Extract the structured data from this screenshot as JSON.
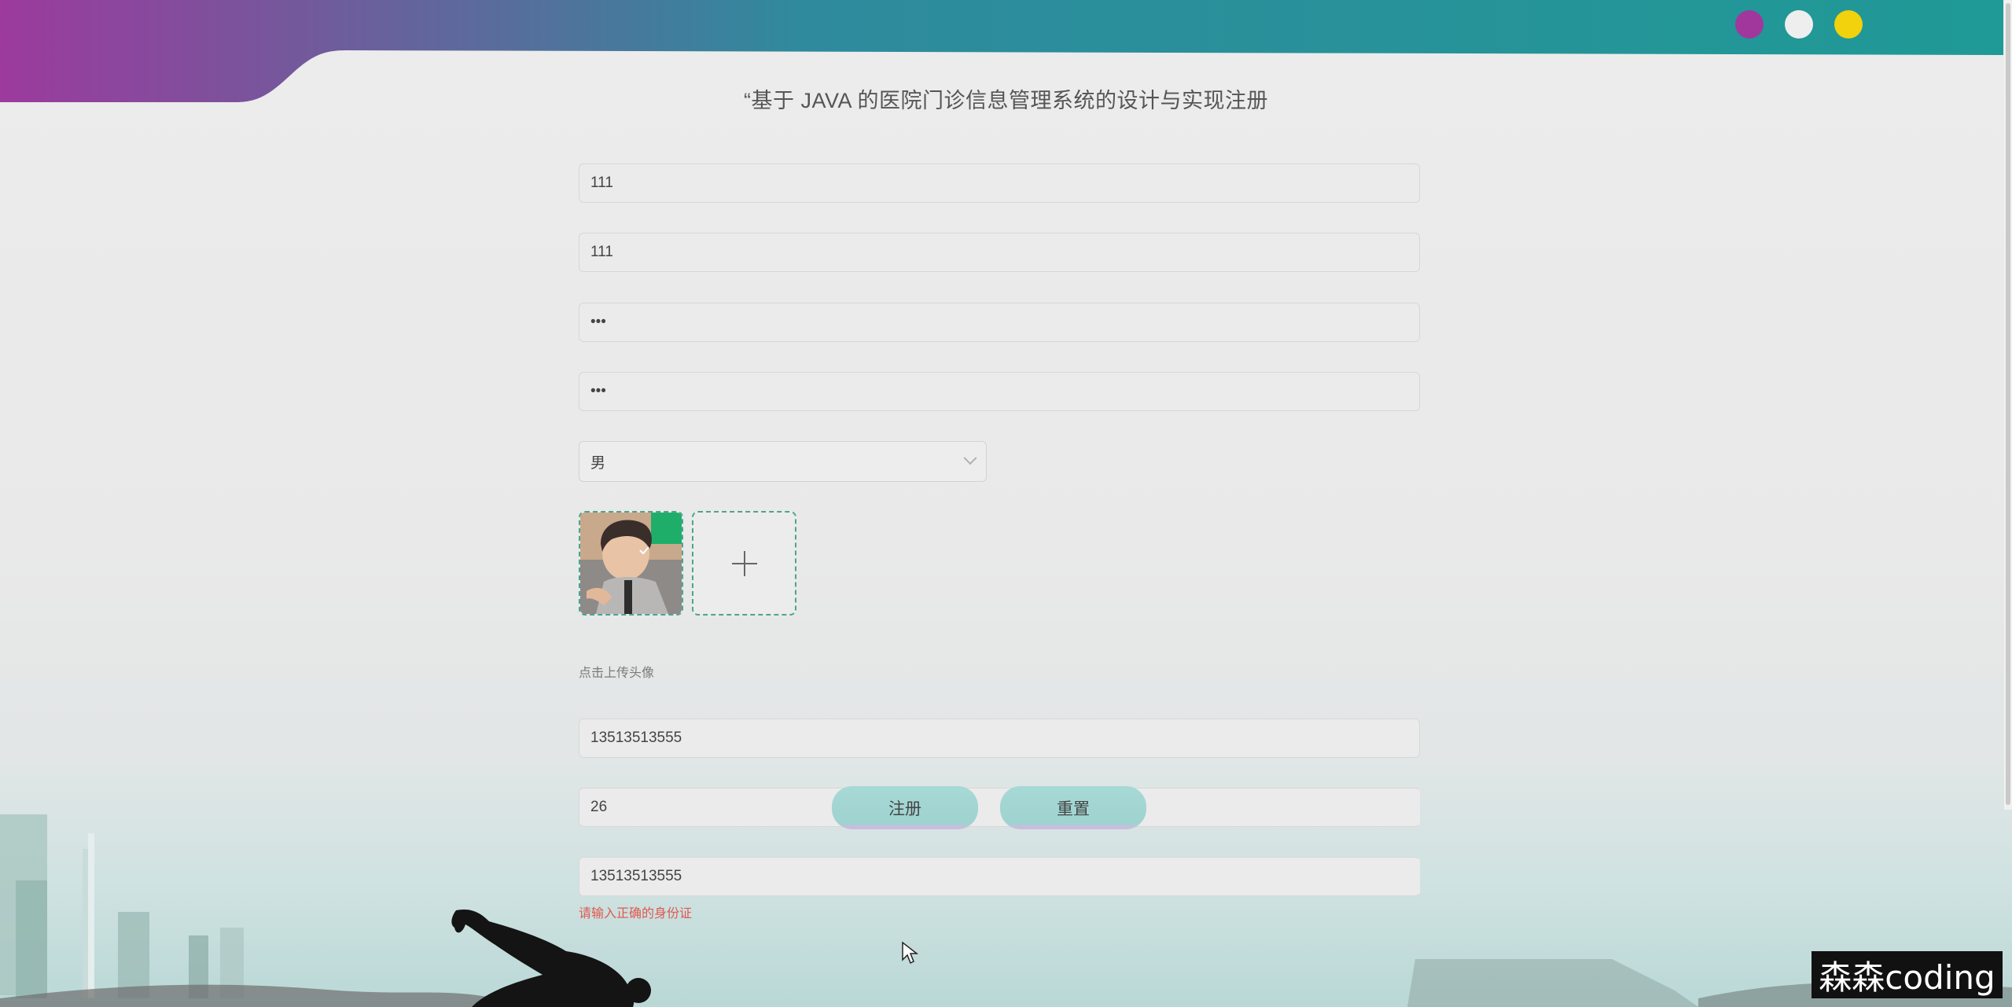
{
  "window": {
    "controls": [
      {
        "name": "purple-dot",
        "color": "#a1379c"
      },
      {
        "name": "white-dot",
        "color": "#eeeeee"
      },
      {
        "name": "yellow-dot",
        "color": "#f2d10d"
      }
    ]
  },
  "header": {
    "title": "“基于 JAVA 的医院门诊信息管理系统的设计与实现注册"
  },
  "form": {
    "account": "111",
    "name": "111",
    "password": "•••",
    "confirm_password": "•••",
    "gender": {
      "selected": "男"
    },
    "avatar": {
      "upload_hint": "点击上传头像"
    },
    "phone": "13513513555",
    "age": "26",
    "id_card": "13513513555",
    "id_card_error": "请输入正确的身份证"
  },
  "actions": {
    "register_label": "注册",
    "reset_label": "重置"
  },
  "watermark": {
    "text": "森森coding"
  },
  "colors": {
    "accent_teal": "#1d9a97",
    "accent_purple": "#9c3a9d",
    "error": "#e1574f"
  }
}
